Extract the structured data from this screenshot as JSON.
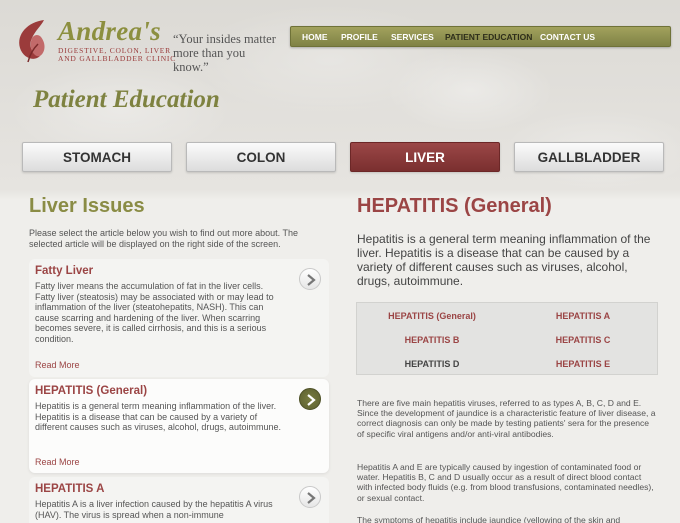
{
  "brand": {
    "name": "Andrea's",
    "subtitle_lines": [
      "Digestive, Colon, Liver",
      "and Gallbladder Clinic"
    ],
    "tagline_lines": [
      "“Your insides matter",
      "more than you know.”"
    ]
  },
  "nav": {
    "items": [
      "HOME",
      "PROFILE",
      "SERVICES",
      "PATIENT EDUCATION",
      "CONTACT US"
    ],
    "active": "PATIENT EDUCATION"
  },
  "page_title": "Patient Education",
  "categories": {
    "items": [
      "STOMACH",
      "COLON",
      "LIVER",
      "GALLBLADDER"
    ],
    "active": "LIVER"
  },
  "left": {
    "title": "Liver Issues",
    "intro": "Please select the article below you wish to find out more about. The selected article will be displayed on the right side of the screen.",
    "articles": [
      {
        "title": "Fatty Liver",
        "body": "Fatty liver means the accumulation of fat in the liver cells. Fatty liver (steatosis) may be associated with or may lead to inflammation of the liver (steatohepatits, NASH). This can cause scarring and hardening of the liver. When scarring becomes severe, it is called cirrhosis, and this is a serious condition.",
        "read_more": "Read More"
      },
      {
        "title": "HEPATITIS (General)",
        "body": "Hepatitis is a general term meaning inflammation of the liver. Hepatitis is a disease that can be caused by a variety of different causes such as viruses, alcohol, drugs, autoimmune.",
        "read_more": "Read More"
      },
      {
        "title": "HEPATITIS A",
        "body": "Hepatitis A is a liver infection caused by the hepatitis A virus (HAV). The virus is spread when a non-immune"
      }
    ]
  },
  "right": {
    "title": "HEPATITIS (General)",
    "lead": "Hepatitis is a general term meaning inflammation of the liver. Hepatitis is a disease that can be caused by a variety of different causes such as viruses, alcohol, drugs, autoimmune.",
    "links": [
      "HEPATITIS (General)",
      "HEPATITIS A",
      "HEPATITIS B",
      "HEPATITIS C",
      "HEPATITIS D",
      "HEPATITIS E"
    ],
    "paragraphs": [
      "There are five main hepatitis viruses, referred to as types A, B, C, D and E. Since the development of jaundice is a characteristic feature of liver disease, a correct diagnosis can only be made by testing patients' sera for the presence of specific viral antigens and/or anti-viral antibodies.",
      "Hepatitis A and E are typically caused by ingestion of contaminated food or water. Hepatitis B, C and D usually occur as a result of direct blood contact with infected body fluids (e.g. from blood transfusions, contaminated needles), or sexual contact.",
      "The symptoms of hepatitis include jaundice (yellowing of the skin and"
    ]
  },
  "colors": {
    "olive": "#8a8c45",
    "maroon": "#9b4545",
    "active_tab": "#8b3c3c"
  }
}
